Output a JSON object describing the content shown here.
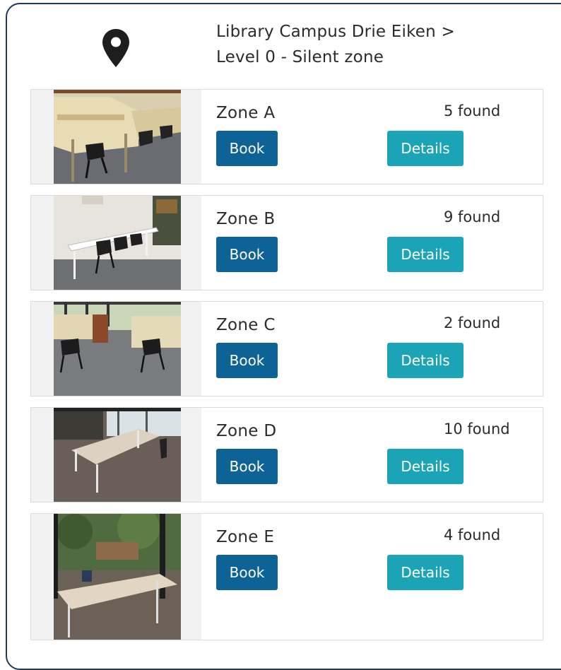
{
  "location": {
    "line1": "Library Campus Drie Eiken >",
    "line2": "Level 0 - Silent zone",
    "icon": "map-pin-icon"
  },
  "colors": {
    "book_button": "#0d6296",
    "details_button": "#1aa4b5",
    "frame_border": "#1f3b5c"
  },
  "zones": [
    {
      "name": "Zone A",
      "found": "5 found",
      "book_label": "Book",
      "details_label": "Details"
    },
    {
      "name": "Zone B",
      "found": "9 found",
      "book_label": "Book",
      "details_label": "Details"
    },
    {
      "name": "Zone C",
      "found": "2 found",
      "book_label": "Book",
      "details_label": "Details"
    },
    {
      "name": "Zone D",
      "found": "10 found",
      "book_label": "Book",
      "details_label": "Details"
    },
    {
      "name": "Zone E",
      "found": "4 found",
      "book_label": "Book",
      "details_label": "Details"
    }
  ]
}
